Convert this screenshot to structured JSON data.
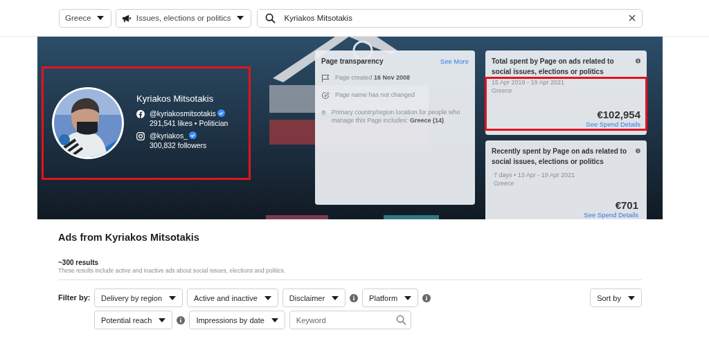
{
  "search_bar": {
    "selectors": [
      {
        "label": "Greece",
        "kind": "plain"
      },
      {
        "label": "Issues, elections or politics",
        "kind": "megaphone"
      }
    ],
    "search": {
      "value": "Kyriakos Mitsotakis"
    }
  },
  "banner": {
    "kind": "picture",
    "profile": {
      "name": "Kyriakos Mitsotakis",
      "highlighted": true,
      "accounts": [
        {
          "kind": "facebook",
          "handle": "@kyriakosmitsotakis",
          "verified": true,
          "stats": "291,541 likes • Politician"
        },
        {
          "kind": "instagram",
          "handle": "@kyriakos_",
          "verified": true,
          "stats": "300,832 followers"
        }
      ]
    },
    "transparency": {
      "title": "Page transparency",
      "link": "See More",
      "items": [
        {
          "kind": "created",
          "text": "Page created **16 Nov 2008**"
        },
        {
          "kind": "name",
          "text": "Page name has not changed"
        },
        {
          "kind": "location",
          "text": "Primary country/region location for people who manage this Page includes: **Greece (14)**"
        }
      ]
    },
    "spend_cards": [
      {
        "title": "Total spent by Page on ads related to social issues, elections or politics",
        "period": "15 Apr 2019 - 19 Apr 2021",
        "region": "Greece",
        "amount": "€102,954",
        "link": "See Spend Details",
        "highlighted": true
      },
      {
        "title": "Recently spent by Page on ads related to social issues, elections or politics",
        "period": "7 days • 13 Apr - 19 Apr 2021",
        "region": "Greece",
        "amount": "€701",
        "link": "See Spend Details",
        "highlighted": false
      }
    ]
  },
  "ads": {
    "title": "Ads from Kyriakos Mitsotakis",
    "count": "~300 results",
    "description": "These results include active and inactive ads about social issues, elections and politics.",
    "filter_label": "Filter by:",
    "filter_rows": [
      [
        {
          "kind": "dropdown",
          "label": "Delivery by region",
          "info": false
        },
        {
          "kind": "dropdown",
          "label": "Active and inactive",
          "info": false
        },
        {
          "kind": "dropdown",
          "label": "Disclaimer",
          "info": true
        },
        {
          "kind": "dropdown",
          "label": "Platform",
          "info": true
        }
      ],
      [
        {
          "kind": "dropdown",
          "label": "Potential reach",
          "info": true
        },
        {
          "kind": "dropdown",
          "label": "Impressions by date",
          "info": false
        },
        {
          "kind": "search",
          "placeholder": "Keyword",
          "info": false
        }
      ]
    ],
    "sort": {
      "label": "Sort by"
    }
  }
}
